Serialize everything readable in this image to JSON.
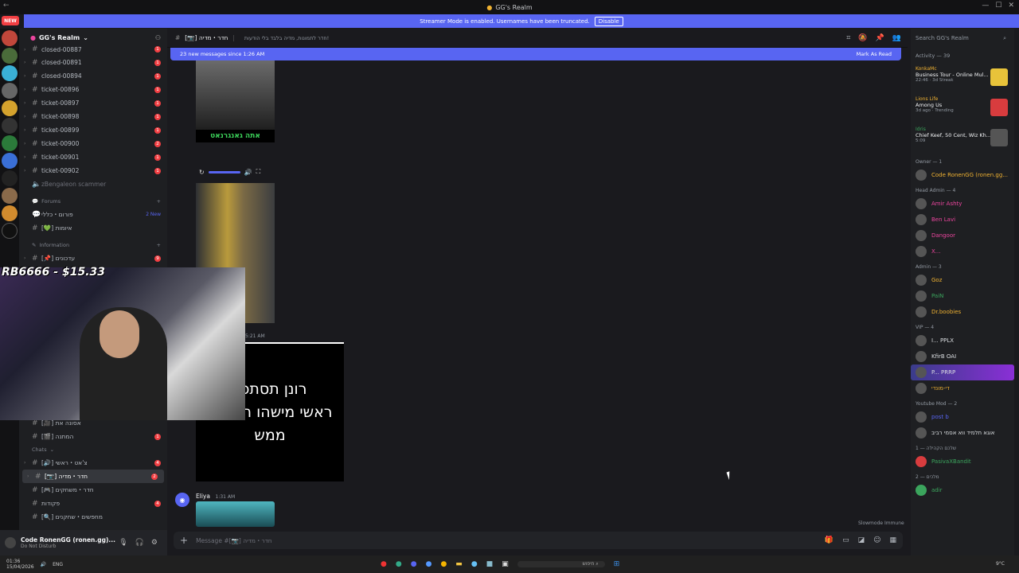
{
  "window": {
    "title": "GG's Realm",
    "new_tag": "NEW"
  },
  "streamer_banner": {
    "text": "Streamer Mode is enabled. Usernames have been truncated.",
    "button": "Disable"
  },
  "guild": {
    "name": "GG's Realm",
    "channels_top": [
      {
        "name": "closed-00887",
        "badge": "1"
      },
      {
        "name": "closed-00891",
        "badge": "1"
      },
      {
        "name": "closed-00894",
        "badge": "1"
      },
      {
        "name": "ticket-00896",
        "badge": "1"
      },
      {
        "name": "ticket-00897",
        "badge": "1"
      },
      {
        "name": "ticket-00898",
        "badge": "1"
      },
      {
        "name": "ticket-00899",
        "badge": "1"
      },
      {
        "name": "ticket-00900",
        "badge": "2"
      },
      {
        "name": "ticket-00901",
        "badge": "1"
      },
      {
        "name": "ticket-00902",
        "badge": "1"
      }
    ],
    "scammer_channel": "zBengaleon scammer",
    "forums_category": "Forums",
    "forum_channels": [
      {
        "name": "פורום・כללי",
        "badge": "2 New"
      },
      {
        "name": "[💚] איומות",
        "badge": ""
      }
    ],
    "information_category": "Information",
    "info_channels": [
      {
        "name": "[📌] עדכונים",
        "badge": "9"
      }
    ],
    "lower_channels": [
      {
        "name": "[🎥] אסונה את",
        "badge": ""
      },
      {
        "name": "[🎬] המתנה",
        "badge": "1"
      }
    ],
    "chats_category": "Chats",
    "chat_channels": [
      {
        "name": "[🔊] צ'אט・ראשי",
        "badge": "4"
      },
      {
        "name": "[📷] חדר・מדיה",
        "badge": "2",
        "selected": true
      },
      {
        "name": "[🎮] חדר・משחקים",
        "badge": ""
      },
      {
        "name": "פקודות",
        "badge": "4"
      },
      {
        "name": "[🔍] מחפשים・שחקנים",
        "badge": ""
      }
    ]
  },
  "user": {
    "name": "Code RonenGG (ronen.gg)...",
    "status": "Do Not Disturb"
  },
  "chat": {
    "header_channel": "[📷] חדר・מדיה",
    "topic": "חדר לתמונות, מדיה בלבד בלי הודעות!",
    "new_messages": "23 new messages since 1:26 AM",
    "mark_read": "Mark As Read",
    "image1_caption": "אתה גאנגרנאט",
    "timestamp1": "5:21 AM",
    "meme_text_lines": [
      "רונן תסתכל",
      "ראשי מישהו הפך לי",
      "ממש"
    ],
    "eliya_name": "Eliya",
    "eliya_time": "1:31 AM",
    "slowmode": "Slowmode Immune",
    "composer_placeholder": "Message #[📷] חדר・מדיה"
  },
  "overlay": {
    "donation": "RB6666 - $15.33"
  },
  "members": {
    "search_placeholder": "Search GG's Realm",
    "activity_header": "Activity — 39",
    "activities": [
      {
        "user": "KonkaMc",
        "title": "Business Tour - Online Mul...",
        "meta": "22:46 · 3d Streak",
        "color": "#f0b232"
      },
      {
        "user": "Lions Life",
        "title": "Among Us",
        "meta": "3d ago · Trending",
        "color": "#d83c3e"
      },
      {
        "user": "Idris",
        "title": "Chief Keef, 50 Cent, Wiz Kh...",
        "meta": "5:09",
        "color": "#444"
      }
    ],
    "groups": [
      {
        "label": "Owner — 1",
        "members": [
          {
            "name": "Code RonenGG (ronen.gg...",
            "color": "#f0b232"
          }
        ]
      },
      {
        "label": "Head Admin — 4",
        "members": [
          {
            "name": "Amir Ashty",
            "color": "#eb459e"
          },
          {
            "name": "Ben Lavi",
            "color": "#eb459e"
          },
          {
            "name": "Dangoor",
            "color": "#eb459e"
          },
          {
            "name": "X...",
            "color": "#eb459e"
          }
        ]
      },
      {
        "label": "Admin — 3",
        "members": [
          {
            "name": "Goz",
            "color": "#f0b232"
          },
          {
            "name": "PaiN",
            "color": "#3ba55d"
          },
          {
            "name": "Dr.boobies",
            "color": "#f0b232"
          }
        ]
      },
      {
        "label": "VIP — 4",
        "members": [
          {
            "name": "I... PPLX",
            "color": "#f2f3f5"
          },
          {
            "name": "KfirB OAI",
            "color": "#f2f3f5"
          },
          {
            "name": "P... PRRP",
            "color": "#f2f3f5"
          },
          {
            "name": "די-מונדי",
            "color": "#f0b232"
          }
        ]
      },
      {
        "label": "Youtube Mod — 2",
        "members": [
          {
            "name": "post b",
            "color": "#5865f2"
          },
          {
            "name": "אוגא תלמיד ווא אסמי רביב",
            "color": "#f2f3f5"
          }
        ]
      },
      {
        "label": "שלכם הקהילה — 1",
        "members": [
          {
            "name": "PasivaXBandit",
            "color": "#3ba55d"
          }
        ]
      },
      {
        "label": "מלכים — 2",
        "members": [
          {
            "name": "adir",
            "color": "#3ba55d"
          }
        ]
      }
    ]
  },
  "taskbar": {
    "time": "01:36",
    "date": "15/04/2026",
    "lang": "ENG",
    "weather": "9°C",
    "search_text": "חיפוש"
  }
}
